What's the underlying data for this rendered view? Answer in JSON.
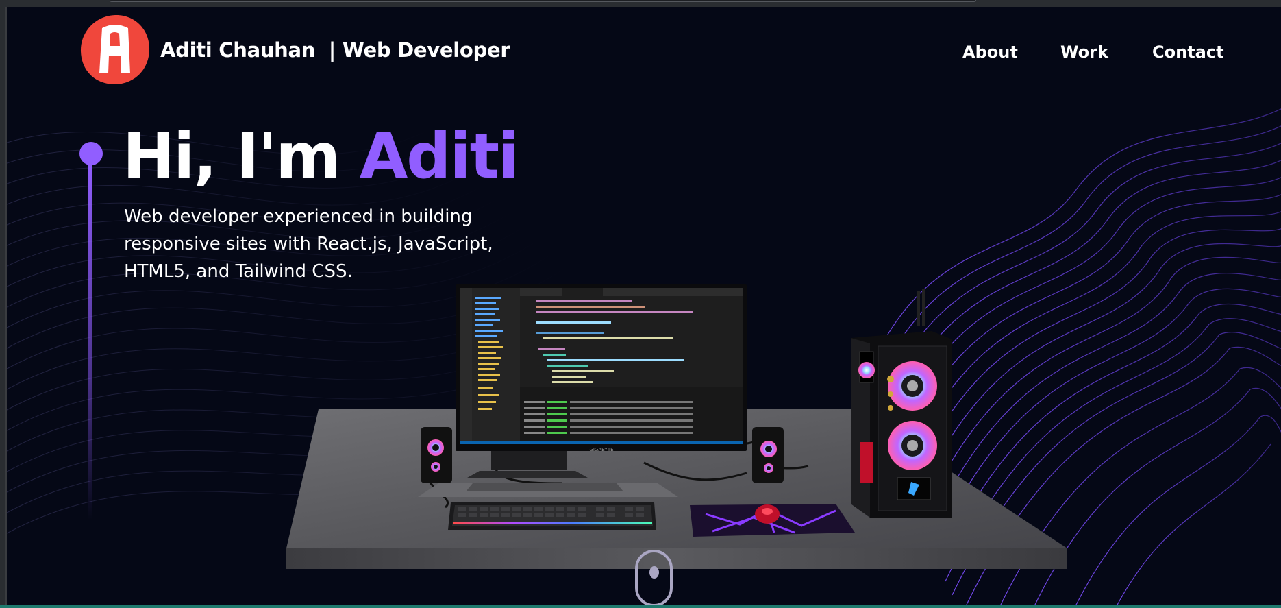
{
  "navbar": {
    "logo_letter": "A",
    "brand_name": "Aditi Chauhan",
    "brand_separator": "|",
    "brand_role": "Web Developer",
    "links": [
      {
        "label": "About"
      },
      {
        "label": "Work"
      },
      {
        "label": "Contact"
      }
    ]
  },
  "hero": {
    "greeting": "Hi, I'm",
    "name": "Aditi",
    "subtitle": "Web developer experienced in building responsive sites with React.js, JavaScript, HTML5, and Tailwind CSS."
  },
  "scene": {
    "monitor_brand": "GIGABYTE"
  },
  "colors": {
    "background": "#050816",
    "accent": "#915eff",
    "logo_red": "#f0473c",
    "text": "#ffffff",
    "scroll_indicator": "#aaa6c3"
  },
  "icons": {
    "logo": "logo-icon",
    "scroll": "mouse-scroll-icon"
  }
}
